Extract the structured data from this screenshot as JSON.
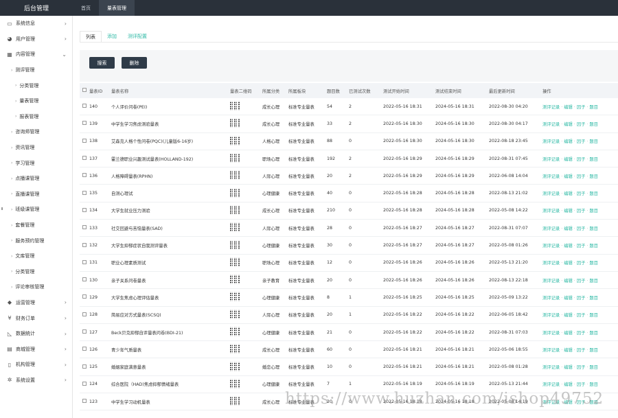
{
  "brand": "后台管理",
  "topnav": [
    {
      "label": "首页",
      "active": false
    },
    {
      "label": "量表管理",
      "active": true
    }
  ],
  "sidebar": [
    {
      "label": "系统信息",
      "level": 0,
      "icon": "monitor-icon",
      "chev": "›"
    },
    {
      "label": "用户管理",
      "level": 0,
      "icon": "users-icon",
      "chev": "›"
    },
    {
      "label": "内容管理",
      "level": 0,
      "icon": "grid-icon",
      "chev": "⌄"
    },
    {
      "label": "测评管理",
      "level": 1,
      "chev": ""
    },
    {
      "label": "分类管理",
      "level": 2,
      "chev": ""
    },
    {
      "label": "量表管理",
      "level": 2,
      "chev": ""
    },
    {
      "label": "报表管理",
      "level": 2,
      "chev": ""
    },
    {
      "label": "咨询师管理",
      "level": 1,
      "chev": ""
    },
    {
      "label": "资讯管理",
      "level": 1,
      "chev": ""
    },
    {
      "label": "学习管理",
      "level": 1,
      "chev": ""
    },
    {
      "label": "点播课管理",
      "level": 1,
      "chev": ""
    },
    {
      "label": "直播课管理",
      "level": 1,
      "chev": ""
    },
    {
      "label": "班级课管理",
      "level": 1,
      "chev": ""
    },
    {
      "label": "套餐管理",
      "level": 1,
      "chev": ""
    },
    {
      "label": "服务预约管理",
      "level": 1,
      "chev": ""
    },
    {
      "label": "文库管理",
      "level": 1,
      "chev": ""
    },
    {
      "label": "分类管理",
      "level": 1,
      "chev": ""
    },
    {
      "label": "评论审核管理",
      "level": 1,
      "chev": ""
    },
    {
      "label": "运营管理",
      "level": 0,
      "icon": "tag-icon",
      "chev": "›"
    },
    {
      "label": "财务订单",
      "level": 0,
      "icon": "yen-icon",
      "chev": "›"
    },
    {
      "label": "数据统计",
      "level": 0,
      "icon": "chart-icon",
      "chev": "›"
    },
    {
      "label": "商城管理",
      "level": 0,
      "icon": "cart-icon",
      "chev": "›"
    },
    {
      "label": "机构管理",
      "level": 0,
      "icon": "building-icon",
      "chev": "›"
    },
    {
      "label": "系统设置",
      "level": 0,
      "icon": "gear-icon",
      "chev": "›"
    }
  ],
  "tabs": [
    {
      "label": "列表",
      "active": true
    },
    {
      "label": "添加",
      "active": false
    },
    {
      "label": "测评配置",
      "active": false
    }
  ],
  "toolbar": {
    "search_label": "搜索",
    "delete_label": "删除"
  },
  "columns": [
    "量表ID",
    "量表名称",
    "量表二维码",
    "所属分类",
    "所属板块",
    "题目数",
    "已测试次数",
    "测试开始时间",
    "测试结束时间",
    "最后更新时间",
    "操作"
  ],
  "operations": [
    "测评记录",
    "编辑",
    "因子",
    "题目"
  ],
  "rows": [
    {
      "id": "140",
      "name": "个人评价问卷(PEI)",
      "cat": "成长心理",
      "type": "标准专业量表",
      "cnt": "54",
      "done": "2",
      "start": "2022-05-16 18:31",
      "end": "2024-05-16 18:31",
      "up": "2022-08-30 04:20"
    },
    {
      "id": "139",
      "name": "中学生学习焦虑测验量表",
      "cat": "成长心理",
      "type": "标准专业量表",
      "cnt": "33",
      "done": "2",
      "start": "2022-05-16 18:30",
      "end": "2024-05-16 18:30",
      "up": "2022-08-30 04:17"
    },
    {
      "id": "138",
      "name": "艾森克人格个性问卷(PQC)(儿童版6-16岁)",
      "cat": "人格心理",
      "type": "标准专业量表",
      "cnt": "88",
      "done": "0",
      "start": "2022-05-16 18:30",
      "end": "2024-05-16 18:30",
      "up": "2022-08-18 23:45"
    },
    {
      "id": "137",
      "name": "霍兰德职业兴趣测试量表(HOLLAND-192)",
      "cat": "职场心理",
      "type": "标准专业量表",
      "cnt": "192",
      "done": "2",
      "start": "2022-05-16 18:29",
      "end": "2024-05-16 18:29",
      "up": "2022-08-31 07:45"
    },
    {
      "id": "136",
      "name": "人格障碍量表(RPHN)",
      "cat": "人际心理",
      "type": "标准专业量表",
      "cnt": "20",
      "done": "2",
      "start": "2022-05-16 18:29",
      "end": "2024-05-16 18:29",
      "up": "2022-06-08 14:04"
    },
    {
      "id": "135",
      "name": "自测心理试",
      "cat": "心理健康",
      "type": "标准专业量表",
      "cnt": "40",
      "done": "0",
      "start": "2022-05-16 18:28",
      "end": "2024-05-16 18:28",
      "up": "2022-08-13 21:02"
    },
    {
      "id": "134",
      "name": "大学生就业压力测验",
      "cat": "成长心理",
      "type": "标准专业量表",
      "cnt": "210",
      "done": "0",
      "start": "2022-05-16 18:28",
      "end": "2024-05-16 18:28",
      "up": "2022-05-08 14:22"
    },
    {
      "id": "133",
      "name": "社交回避与苦恼量表(SAD)",
      "cat": "人际心理",
      "type": "标准专业量表",
      "cnt": "28",
      "done": "0",
      "start": "2022-05-16 18:27",
      "end": "2024-05-16 18:27",
      "up": "2022-08-31 07:07"
    },
    {
      "id": "132",
      "name": "大学生抑郁症状自我测评量表",
      "cat": "心理健康",
      "type": "标准专业量表",
      "cnt": "30",
      "done": "0",
      "start": "2022-05-16 18:27",
      "end": "2024-05-16 18:27",
      "up": "2022-05-08 01:26"
    },
    {
      "id": "131",
      "name": "职业心理素质测试",
      "cat": "职场心理",
      "type": "标准专业量表",
      "cnt": "12",
      "done": "0",
      "start": "2022-05-16 18:26",
      "end": "2024-05-16 18:26",
      "up": "2022-05-13 21:20"
    },
    {
      "id": "130",
      "name": "亲子关系问卷量表",
      "cat": "亲子教育",
      "type": "标准专业量表",
      "cnt": "20",
      "done": "0",
      "start": "2022-05-16 18:26",
      "end": "2024-05-16 18:26",
      "up": "2022-08-13 22:18"
    },
    {
      "id": "129",
      "name": "大学生焦虑心理评估量表",
      "cat": "心理健康",
      "type": "标准专业量表",
      "cnt": "8",
      "done": "1",
      "start": "2022-05-16 18:25",
      "end": "2024-05-16 18:25",
      "up": "2022-05-09 13:22"
    },
    {
      "id": "128",
      "name": "简易应对方式量表(SCSQ)",
      "cat": "人际心理",
      "type": "标准专业量表",
      "cnt": "20",
      "done": "1",
      "start": "2022-05-16 18:22",
      "end": "2024-05-16 18:22",
      "up": "2022-06-05 18:42"
    },
    {
      "id": "127",
      "name": "Beck贝克抑郁自评量表问卷(BDI-21)",
      "cat": "心理健康",
      "type": "标准专业量表",
      "cnt": "21",
      "done": "0",
      "start": "2022-05-16 18:22",
      "end": "2024-05-16 18:22",
      "up": "2022-08-31 07:03"
    },
    {
      "id": "126",
      "name": "青少年气质量表",
      "cat": "成长心理",
      "type": "标准专业量表",
      "cnt": "60",
      "done": "0",
      "start": "2022-05-16 18:21",
      "end": "2024-05-16 18:21",
      "up": "2022-05-06 18:55"
    },
    {
      "id": "125",
      "name": "婚姻家庭满意量表",
      "cat": "婚恋心理",
      "type": "标准专业量表",
      "cnt": "10",
      "done": "0",
      "start": "2022-05-16 18:21",
      "end": "2024-05-16 18:21",
      "up": "2022-05-08 01:28"
    },
    {
      "id": "124",
      "name": "综合医院（HAD)焦虑抑郁情绪量表",
      "cat": "心理健康",
      "type": "标准专业量表",
      "cnt": "7",
      "done": "1",
      "start": "2022-05-16 18:19",
      "end": "2024-05-16 18:19",
      "up": "2022-05-13 21:44"
    },
    {
      "id": "123",
      "name": "中学生学习动机量表",
      "cat": "成长心理",
      "type": "标准专业量表",
      "cnt": "20",
      "done": "0",
      "start": "2022-05-16 18:18",
      "end": "2024-05-16 18:18",
      "up": "2022-05-08 14:19"
    }
  ],
  "watermark": "https://www.huzhan.com/ishop49752"
}
